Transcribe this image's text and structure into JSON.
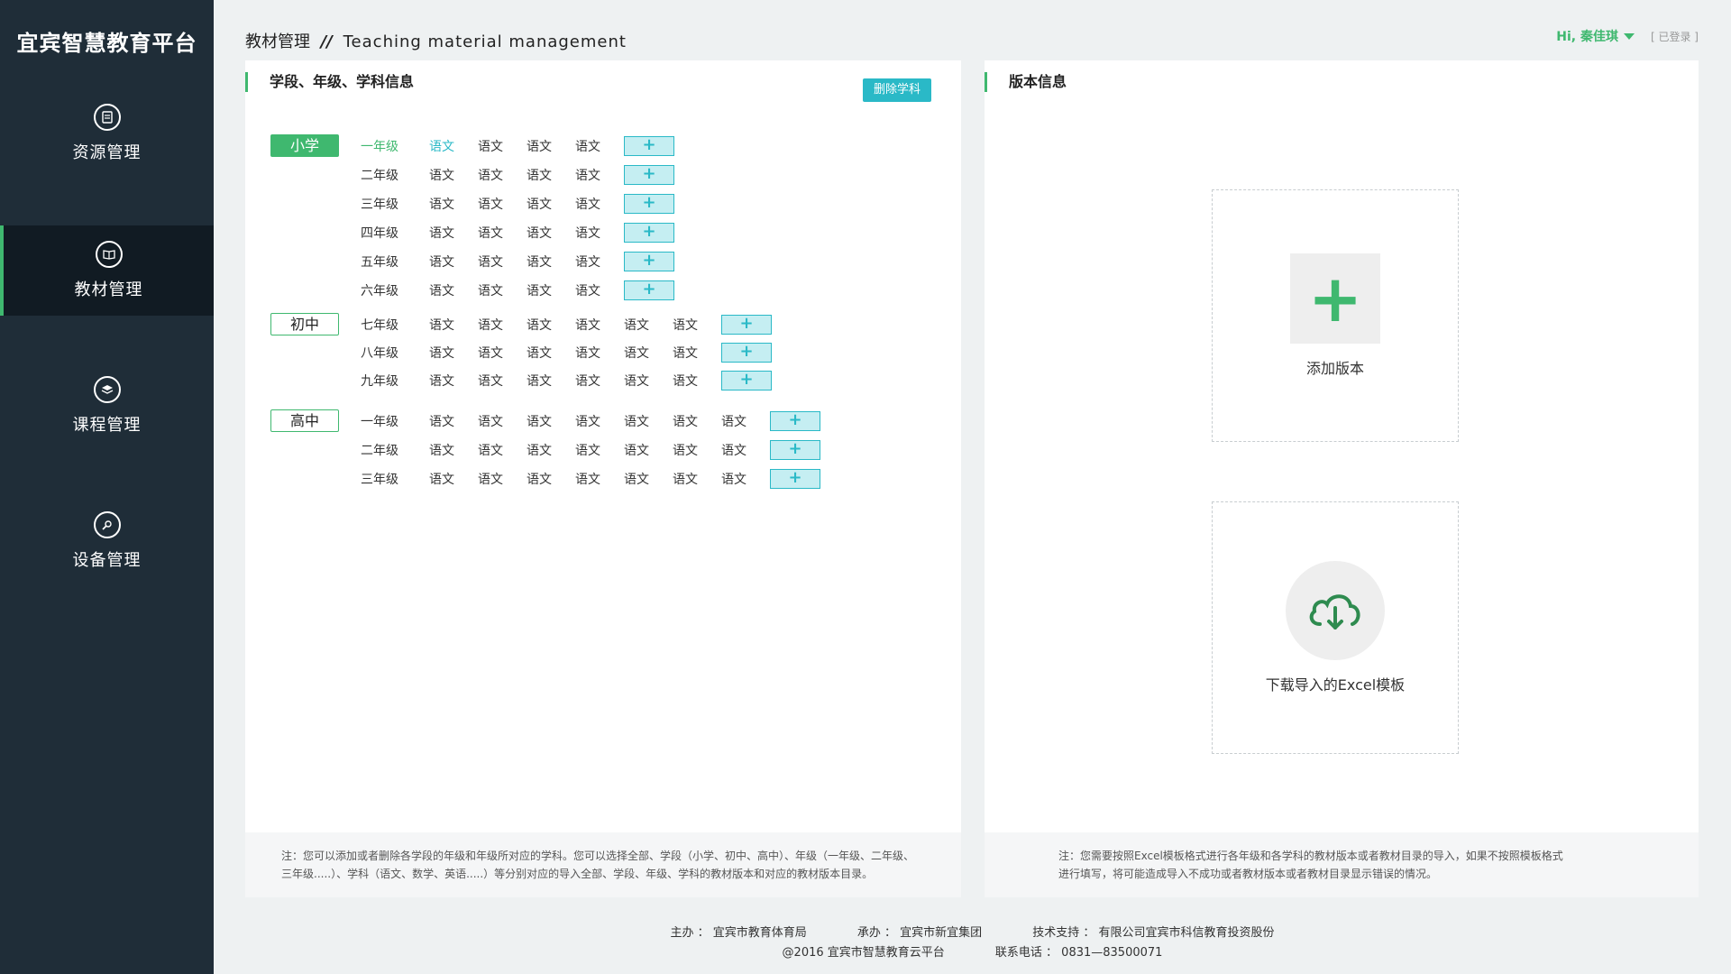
{
  "sidebar": {
    "logo": "宜宾智慧教育平台",
    "items": [
      {
        "label": "资源管理",
        "icon": "document-icon"
      },
      {
        "label": "教材管理",
        "icon": "book-icon"
      },
      {
        "label": "课程管理",
        "icon": "layers-icon"
      },
      {
        "label": "设备管理",
        "icon": "wrench-icon"
      }
    ]
  },
  "header": {
    "title_cn": "教材管理",
    "separator": "//",
    "title_en": "Teaching material management",
    "user": "Hi, 秦佳琪",
    "login_state": "[ 已登录 ]"
  },
  "left_panel": {
    "title": "学段、年级、学科信息",
    "delete_button": "删除学科",
    "add_symbol": "+",
    "stages": [
      {
        "name": "小学",
        "grades": [
          {
            "name": "一年级",
            "subjects": [
              "语文",
              "语文",
              "语文",
              "语文"
            ]
          },
          {
            "name": "二年级",
            "subjects": [
              "语文",
              "语文",
              "语文",
              "语文"
            ]
          },
          {
            "name": "三年级",
            "subjects": [
              "语文",
              "语文",
              "语文",
              "语文"
            ]
          },
          {
            "name": "四年级",
            "subjects": [
              "语文",
              "语文",
              "语文",
              "语文"
            ]
          },
          {
            "name": "五年级",
            "subjects": [
              "语文",
              "语文",
              "语文",
              "语文"
            ]
          },
          {
            "name": "六年级",
            "subjects": [
              "语文",
              "语文",
              "语文",
              "语文"
            ]
          }
        ]
      },
      {
        "name": "初中",
        "grades": [
          {
            "name": "七年级",
            "subjects": [
              "语文",
              "语文",
              "语文",
              "语文",
              "语文",
              "语文"
            ]
          },
          {
            "name": "八年级",
            "subjects": [
              "语文",
              "语文",
              "语文",
              "语文",
              "语文",
              "语文"
            ]
          },
          {
            "name": "九年级",
            "subjects": [
              "语文",
              "语文",
              "语文",
              "语文",
              "语文",
              "语文"
            ]
          }
        ]
      },
      {
        "name": "高中",
        "grades": [
          {
            "name": "一年级",
            "subjects": [
              "语文",
              "语文",
              "语文",
              "语文",
              "语文",
              "语文",
              "语文"
            ]
          },
          {
            "name": "二年级",
            "subjects": [
              "语文",
              "语文",
              "语文",
              "语文",
              "语文",
              "语文",
              "语文"
            ]
          },
          {
            "name": "三年级",
            "subjects": [
              "语文",
              "语文",
              "语文",
              "语文",
              "语文",
              "语文",
              "语文"
            ]
          }
        ]
      }
    ],
    "note_line1": "注：您可以添加或者删除各学段的年级和年级所对应的学科。您可以选择全部、学段（小学、初中、高中）、年级（一年级、二年级、",
    "note_line2": "三年级.....）、学科（语文、数学、英语.....）等分别对应的导入全部、学段、年级、学科的教材版本和对应的教材版本目录。"
  },
  "right_panel": {
    "title": "版本信息",
    "add_label": "添加版本",
    "add_symbol": "+",
    "download_label": "下载导入的Excel模板",
    "note_line1": "注：您需要按照Excel模板格式进行各年级和各学科的教材版本或者教材目录的导入，如果不按照模板格式",
    "note_line2": "进行填写，将可能造成导入不成功或者教材版本或者教材目录显示错误的情况。"
  },
  "footer": {
    "host": "主办 ：  宜宾市教育体育局",
    "organizer": "承办 ：  宜宾市新宜集团",
    "support": "技术支持 ：  有限公司宜宾市科信教育投资股份",
    "copyright": "@2016   宜宾市智慧教育云平台",
    "phone": "联系电话 ：  0831—83500071"
  },
  "colors": {
    "accent": "#3fb86f",
    "teal": "#2ab9c7",
    "sidebar": "#1f2d38"
  }
}
